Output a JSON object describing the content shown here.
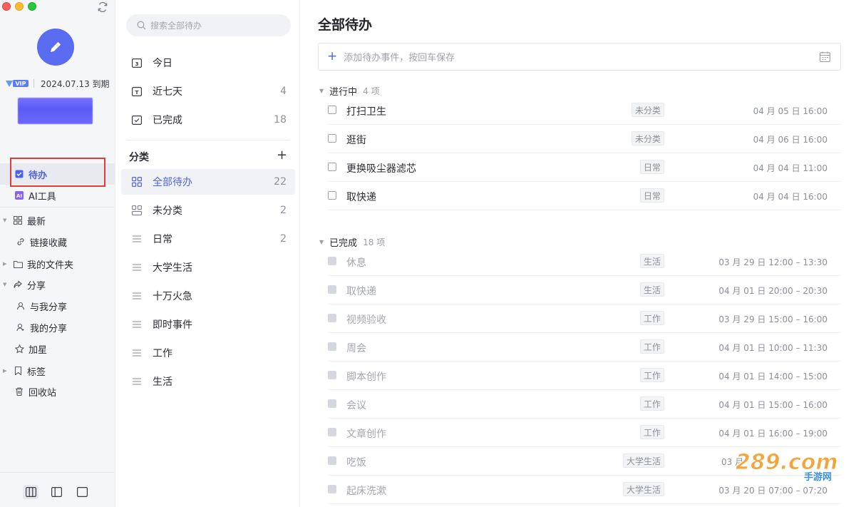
{
  "sidebar": {
    "vip_label": "VIP",
    "expiry": "2024.07.13 到期",
    "items": [
      {
        "label": "待办",
        "icon": "checkbox-icon",
        "active": true
      },
      {
        "label": "AI工具",
        "icon": "ai-icon"
      },
      {
        "label": "最新",
        "icon": "grid-icon",
        "expandable": true
      },
      {
        "label": "链接收藏",
        "icon": "link-icon"
      },
      {
        "label": "我的文件夹",
        "icon": "folder-icon",
        "expandable": true
      },
      {
        "label": "分享",
        "icon": "share-icon",
        "expandable": true
      },
      {
        "label": "与我分享",
        "icon": "user-icon"
      },
      {
        "label": "我的分享",
        "icon": "user-share-icon"
      },
      {
        "label": "加星",
        "icon": "star-icon"
      },
      {
        "label": "标签",
        "icon": "bookmark-icon",
        "expandable": true
      },
      {
        "label": "回收站",
        "icon": "trash-icon"
      }
    ]
  },
  "middle": {
    "search_placeholder": "搜索全部待办",
    "quick": [
      {
        "label": "今日",
        "count": "",
        "icon": "calendar-3-icon"
      },
      {
        "label": "近七天",
        "count": "4",
        "icon": "calendar-t-icon"
      },
      {
        "label": "已完成",
        "count": "18",
        "icon": "calendar-check-icon"
      }
    ],
    "category_title": "分类",
    "categories": [
      {
        "label": "全部待办",
        "count": "22",
        "icon": "grid-icon",
        "selected": true
      },
      {
        "label": "未分类",
        "count": "2",
        "icon": "uncategorized-icon"
      },
      {
        "label": "日常",
        "count": "2",
        "icon": "list-icon"
      },
      {
        "label": "大学生活",
        "count": "",
        "icon": "list-icon"
      },
      {
        "label": "十万火急",
        "count": "",
        "icon": "list-icon"
      },
      {
        "label": "即时事件",
        "count": "",
        "icon": "list-icon"
      },
      {
        "label": "工作",
        "count": "",
        "icon": "list-icon"
      },
      {
        "label": "生活",
        "count": "",
        "icon": "list-icon"
      }
    ]
  },
  "main": {
    "title": "全部待办",
    "add_placeholder": "添加待办事件，按回车保存",
    "in_progress": {
      "label": "进行中",
      "count": "4 项",
      "tasks": [
        {
          "name": "打扫卫生",
          "tag": "未分类",
          "time": "04 月 05 日 16:00"
        },
        {
          "name": "逛街",
          "tag": "未分类",
          "time": "04 月 06 日 16:00"
        },
        {
          "name": "更换吸尘器滤芯",
          "tag": "日常",
          "time": "04 月 04 日 11:00"
        },
        {
          "name": "取快递",
          "tag": "日常",
          "time": "04 月 04 日 16:00"
        }
      ]
    },
    "completed": {
      "label": "已完成",
      "count": "18 项",
      "tasks": [
        {
          "name": "休息",
          "tag": "生活",
          "time": "03 月 29 日 12:00 – 13:30"
        },
        {
          "name": "取快递",
          "tag": "生活",
          "time": "04 月 01 日 20:00 – 20:30"
        },
        {
          "name": "视频验收",
          "tag": "工作",
          "time": "03 月 29 日 15:00 – 16:00"
        },
        {
          "name": "周会",
          "tag": "工作",
          "time": "04 月 01 日 10:00 – 11:30"
        },
        {
          "name": "脚本创作",
          "tag": "工作",
          "time": "04 月 01 日 14:00 – 15:00"
        },
        {
          "name": "会议",
          "tag": "工作",
          "time": "04 月 01 日 15:00 – 16:00"
        },
        {
          "name": "文章创作",
          "tag": "工作",
          "time": "04 月 01 日 16:00 – 19:00"
        },
        {
          "name": "吃饭",
          "tag": "大学生活",
          "time": "03 月"
        },
        {
          "name": "起床洗漱",
          "tag": "大学生活",
          "time": "03 月 20 日 07:00 – 07:20"
        }
      ]
    }
  },
  "watermark": {
    "text": "289.com",
    "subtext": "手游网"
  },
  "colors": {
    "accent": "#4f62e6",
    "highlight_box": "#e53a35",
    "avatar": "#5a6cf0"
  }
}
